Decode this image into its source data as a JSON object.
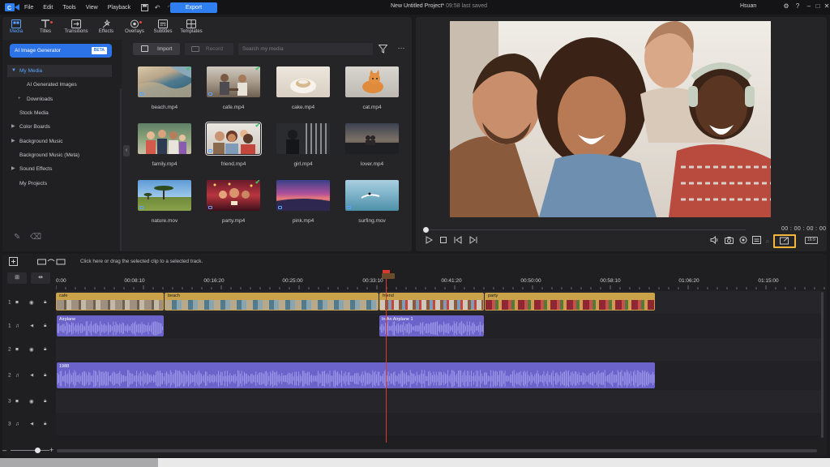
{
  "menubar": {
    "items": [
      "File",
      "Edit",
      "Tools",
      "View",
      "Playback"
    ],
    "export_label": "Export",
    "project_title": "New Untitled Project*",
    "saved_status": "09:58 last saved",
    "user_name": "Hsuan"
  },
  "tabs": [
    {
      "label": "Media",
      "icon": "media-icon",
      "active": true
    },
    {
      "label": "Titles",
      "icon": "titles-icon",
      "dot": true
    },
    {
      "label": "Transitions",
      "icon": "transitions-icon"
    },
    {
      "label": "Effects",
      "icon": "effects-icon"
    },
    {
      "label": "Overlays",
      "icon": "overlays-icon",
      "dot": true
    },
    {
      "label": "Subtitles",
      "icon": "subtitles-icon"
    },
    {
      "label": "Templates",
      "icon": "templates-icon"
    }
  ],
  "sidebar": {
    "ai_button": "AI Image Generator",
    "beta": "BETA",
    "items": [
      {
        "label": "My Media",
        "caret": "▼",
        "selected": true
      },
      {
        "label": "AI Generated Images",
        "sub": true
      },
      {
        "label": "Downloads",
        "sub": true,
        "caret": "+"
      },
      {
        "label": "Stock Media"
      },
      {
        "label": "Color Boards",
        "caret": "▶"
      },
      {
        "label": "Background Music",
        "caret": "▶"
      },
      {
        "label": "Background Music (Meta)"
      },
      {
        "label": "Sound Effects",
        "caret": "▶"
      },
      {
        "label": "My Projects"
      }
    ]
  },
  "content_bar": {
    "import_label": "Import",
    "record_label": "Record",
    "search_placeholder": "Search my media"
  },
  "media": [
    {
      "name": "beach.mp4",
      "checked": true
    },
    {
      "name": "cafe.mp4",
      "checked": true
    },
    {
      "name": "cake.mp4"
    },
    {
      "name": "cat.mp4"
    },
    {
      "name": "family.mp4"
    },
    {
      "name": "friend.mp4",
      "checked": true,
      "selected": true
    },
    {
      "name": "girl.mp4"
    },
    {
      "name": "lover.mp4"
    },
    {
      "name": "nature.mov"
    },
    {
      "name": "party.mp4",
      "checked": true
    },
    {
      "name": "pink.mp4"
    },
    {
      "name": "surfing.mov"
    }
  ],
  "preview": {
    "timecode": "00 : 00 : 00 : 00",
    "ratio": "16:9",
    "progress": 0
  },
  "timeline": {
    "hint": "Click here or drag the selected clip to a selected track.",
    "ruler": [
      "0:00",
      "00:08:10",
      "00:16:20",
      "00:25:00",
      "00:33:10",
      "00:41:20",
      "00:50:00",
      "00:58:10",
      "01:06:20",
      "01:15:00"
    ],
    "tracks": [
      "1",
      "1",
      "2",
      "2",
      "3",
      "3"
    ],
    "video_clips": [
      {
        "label": "cafe"
      },
      {
        "label": "beach"
      },
      {
        "label": "friend"
      },
      {
        "label": "party"
      }
    ],
    "audio_clips": [
      {
        "label": "Airplane"
      },
      {
        "label": "In An Airplane 1"
      },
      {
        "label": "1988"
      }
    ]
  },
  "colors": {
    "accent": "#2f7ff0",
    "video_clip": "#c9a24a",
    "audio_clip": "#6b63c9",
    "playhead": "#d93a2f",
    "highlight": "#f5b73b"
  }
}
